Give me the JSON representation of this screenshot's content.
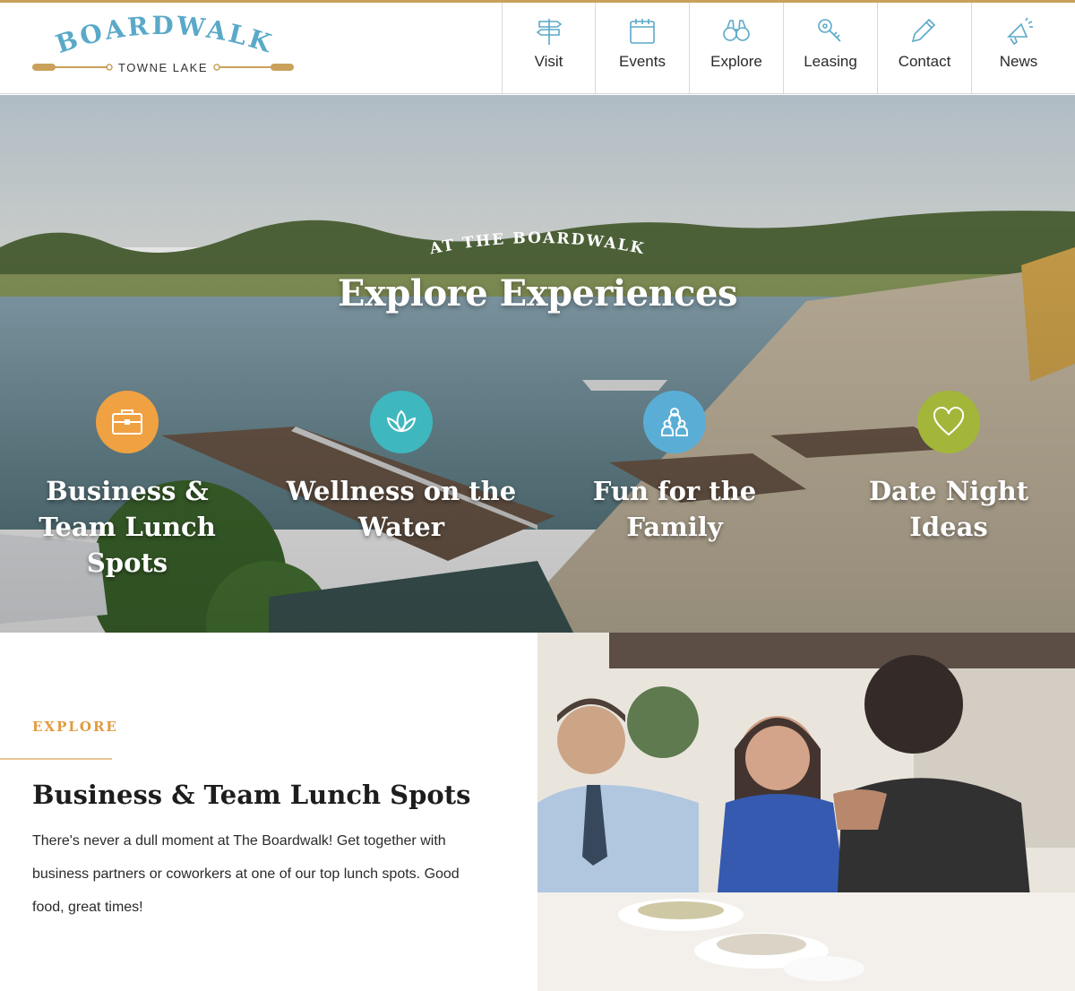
{
  "brand": {
    "name": "BOARDWALK",
    "tagline": "TOWNE LAKE"
  },
  "nav": [
    {
      "label": "Visit",
      "icon": "signpost-icon"
    },
    {
      "label": "Events",
      "icon": "calendar-icon"
    },
    {
      "label": "Explore",
      "icon": "binoculars-icon"
    },
    {
      "label": "Leasing",
      "icon": "key-icon"
    },
    {
      "label": "Contact",
      "icon": "pencil-icon"
    },
    {
      "label": "News",
      "icon": "megaphone-icon"
    }
  ],
  "hero": {
    "eyebrow": "AT THE BOARDWALK",
    "title": "Explore Experiences",
    "features": [
      {
        "label": "Business & Team Lunch Spots",
        "icon": "briefcase-icon",
        "color": "#f0a141"
      },
      {
        "label": "Wellness on the Water",
        "icon": "lotus-icon",
        "color": "#3fb7be"
      },
      {
        "label": "Fun for the Family",
        "icon": "family-icon",
        "color": "#5aaed6"
      },
      {
        "label": "Date Night Ideas",
        "icon": "heart-icon",
        "color": "#a3b63a"
      }
    ]
  },
  "section": {
    "eyebrow": "EXPLORE",
    "title": "Business & Team Lunch Spots",
    "body": "There's never a dull moment at The Boardwalk! Get together with business partners or coworkers at one of our top lunch spots. Good food, great times!"
  },
  "colors": {
    "accent": "#e29a3c",
    "brand_blue": "#5aa9c9",
    "gold": "#c9a15a"
  }
}
